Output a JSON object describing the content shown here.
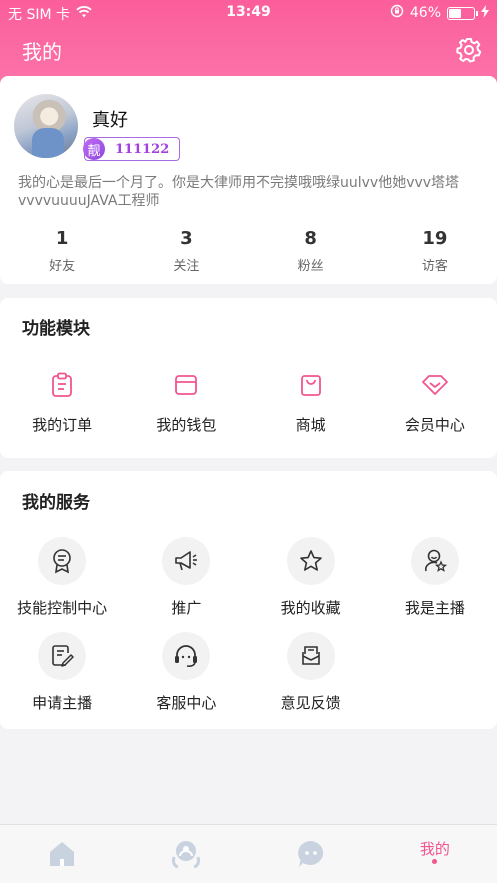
{
  "status_bar": {
    "carrier": "无 SIM 卡",
    "time": "13:49",
    "battery": "46%"
  },
  "header": {
    "title": "我的"
  },
  "profile": {
    "name": "真好",
    "badge_tag": "靓",
    "badge_number": "111122",
    "bio": "我的心是最后一个月了。你是大律师用不完摸哦哦绿uulvv他她vvv塔塔vvvvuuuuJAVA工程师",
    "stats": [
      {
        "value": "1",
        "label": "好友"
      },
      {
        "value": "3",
        "label": "关注"
      },
      {
        "value": "8",
        "label": "粉丝"
      },
      {
        "value": "19",
        "label": "访客"
      }
    ]
  },
  "functions": {
    "title": "功能模块",
    "items": [
      {
        "label": "我的订单",
        "icon": "order-icon"
      },
      {
        "label": "我的钱包",
        "icon": "wallet-icon"
      },
      {
        "label": "商城",
        "icon": "shop-icon"
      },
      {
        "label": "会员中心",
        "icon": "diamond-icon"
      }
    ]
  },
  "services": {
    "title": "我的服务",
    "items": [
      {
        "label": "技能控制中心",
        "icon": "skill-icon"
      },
      {
        "label": "推广",
        "icon": "megaphone-icon"
      },
      {
        "label": "我的收藏",
        "icon": "star-icon"
      },
      {
        "label": "我是主播",
        "icon": "anchor-icon"
      },
      {
        "label": "申请主播",
        "icon": "apply-icon"
      },
      {
        "label": "客服中心",
        "icon": "headset-icon"
      },
      {
        "label": "意见反馈",
        "icon": "feedback-icon"
      }
    ]
  },
  "tabbar": {
    "active_label": "我的"
  },
  "colors": {
    "accent": "#fb5e9a",
    "tab_active": "#f2558f",
    "icon_inactive": "#c9d3e0"
  }
}
